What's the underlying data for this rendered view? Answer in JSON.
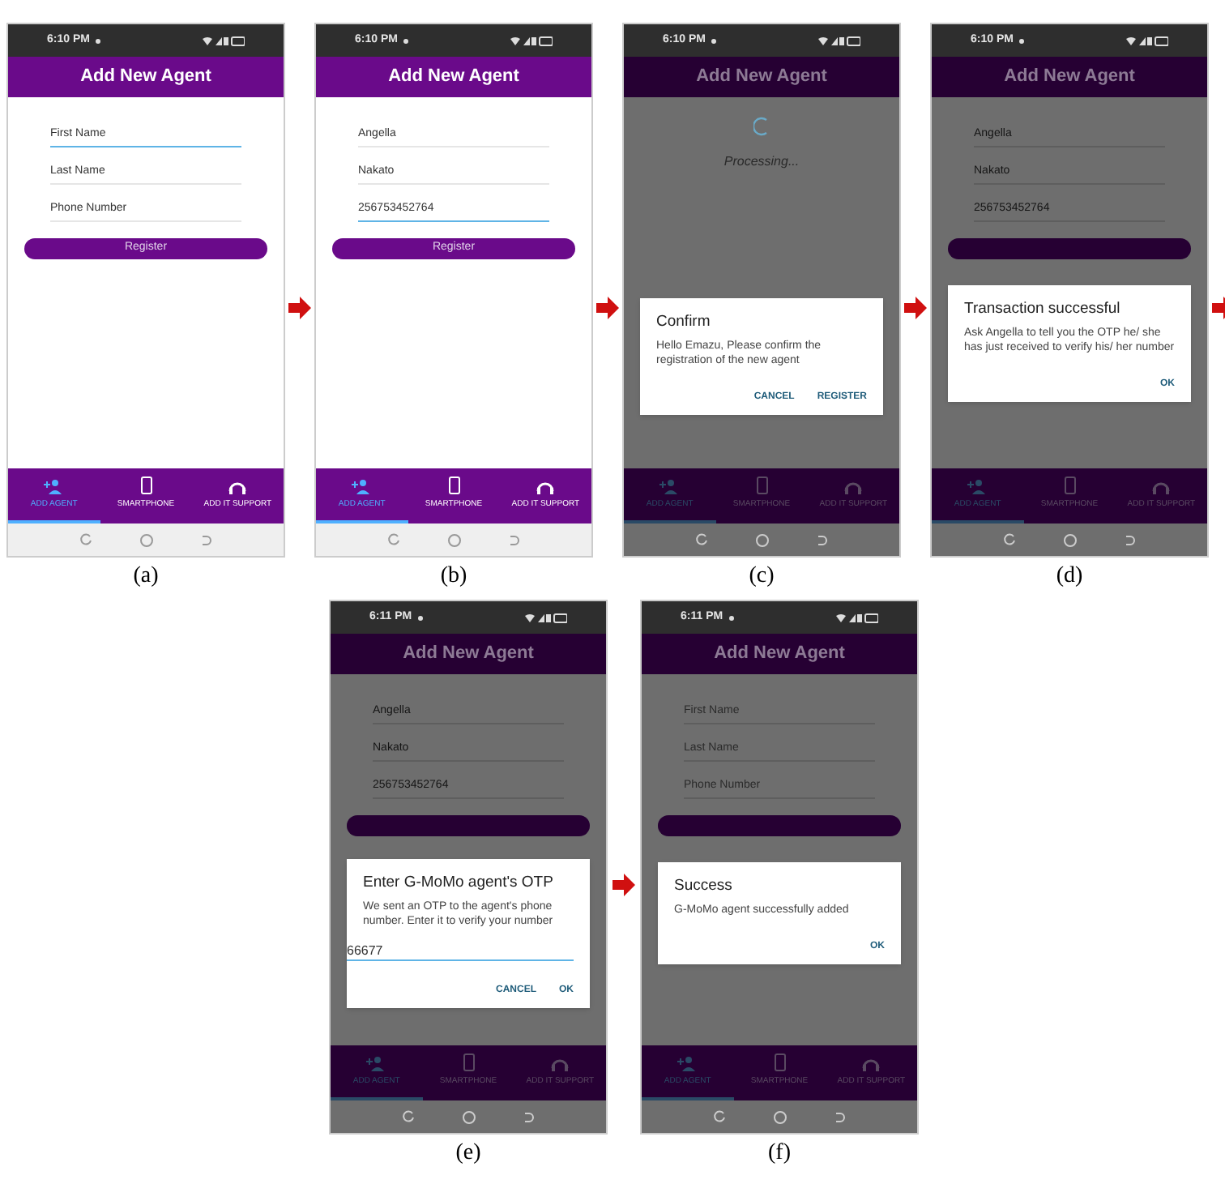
{
  "rows": [
    {
      "items": [
        {
          "kind": "phone",
          "caption": "(a)",
          "time": "6:10 PM",
          "title": "Add New Agent",
          "dimmed": false,
          "fields": [
            {
              "placeholder": "First Name",
              "focused": true
            },
            {
              "placeholder": "Last Name",
              "focused": false
            },
            {
              "placeholder": "Phone Number",
              "focused": false
            }
          ],
          "register_button": {
            "label": "Register"
          },
          "tabs": [
            {
              "label": "ADD AGENT",
              "selected": true
            },
            {
              "label": "SMARTPHONE",
              "selected": false
            },
            {
              "label": "ADD IT SUPPORT",
              "selected": false
            }
          ]
        },
        {
          "kind": "arrow"
        },
        {
          "kind": "phone",
          "caption": "(b)",
          "time": "6:10 PM",
          "title": "Add New Agent",
          "dimmed": false,
          "fields": [
            {
              "value": "Angella",
              "focused": false
            },
            {
              "value": "Nakato",
              "focused": false
            },
            {
              "value": "256753452764",
              "focused": true
            }
          ],
          "register_button": {
            "label": "Register"
          },
          "tabs": [
            {
              "label": "ADD AGENT",
              "selected": true
            },
            {
              "label": "SMARTPHONE",
              "selected": false
            },
            {
              "label": "ADD IT SUPPORT",
              "selected": false
            }
          ]
        },
        {
          "kind": "arrow"
        },
        {
          "kind": "phone",
          "caption": "(c)",
          "time": "6:10 PM",
          "title": "Add New Agent",
          "dimmed": true,
          "processing": {
            "text": "Processing..."
          },
          "dialog": {
            "title": "Confirm",
            "message": "Hello Emazu, Please confirm the registration of the new agent",
            "actions": [
              "CANCEL",
              "REGISTER"
            ]
          },
          "tabs": [
            {
              "label": "ADD AGENT",
              "selected": true
            },
            {
              "label": "SMARTPHONE",
              "selected": false
            },
            {
              "label": "ADD IT SUPPORT",
              "selected": false
            }
          ]
        },
        {
          "kind": "arrow"
        },
        {
          "kind": "phone",
          "caption": "(d)",
          "time": "6:10 PM",
          "title": "Add New Agent",
          "dimmed": true,
          "fields": [
            {
              "value": "Angella",
              "focused": false
            },
            {
              "value": "Nakato",
              "focused": false
            },
            {
              "value": "256753452764",
              "focused": false
            }
          ],
          "register_button": {
            "shown": true
          },
          "dialog": {
            "title": "Transaction successful",
            "message": "Ask Angella to tell you the OTP he/ she has just received to verify his/ her number",
            "actions": [
              "OK"
            ]
          },
          "tabs": [
            {
              "label": "ADD AGENT",
              "selected": true
            },
            {
              "label": "SMARTPHONE",
              "selected": false
            },
            {
              "label": "ADD IT SUPPORT",
              "selected": false
            }
          ]
        },
        {
          "kind": "arrow"
        }
      ]
    },
    {
      "items": [
        {
          "kind": "phone",
          "caption": "(e)",
          "time": "6:11 PM",
          "title": "Add New Agent",
          "dimmed": true,
          "fields": [
            {
              "value": "Angella",
              "focused": false
            },
            {
              "value": "Nakato",
              "focused": false
            },
            {
              "value": "256753452764",
              "focused": false
            }
          ],
          "register_button": {
            "shown": true
          },
          "dialog": {
            "title": "Enter G-MoMo agent's OTP",
            "message": "We sent an OTP to the agent's phone number. Enter it to verify your number",
            "input_value": "66677",
            "actions": [
              "CANCEL",
              "OK"
            ]
          },
          "tabs": [
            {
              "label": "ADD AGENT",
              "selected": true
            },
            {
              "label": "SMARTPHONE",
              "selected": false
            },
            {
              "label": "ADD IT SUPPORT",
              "selected": false
            }
          ]
        },
        {
          "kind": "arrow"
        },
        {
          "kind": "phone",
          "caption": "(f)",
          "time": "6:11 PM",
          "title": "Add New Agent",
          "dimmed": true,
          "fields": [
            {
              "placeholder": "First Name",
              "focused": false
            },
            {
              "placeholder": "Last Name",
              "focused": false
            },
            {
              "placeholder": "Phone Number",
              "focused": false
            }
          ],
          "register_button": {
            "shown": true
          },
          "dialog": {
            "title": "Success",
            "message": "G-MoMo agent successfully added",
            "actions": [
              "OK"
            ]
          },
          "tabs": [
            {
              "label": "ADD AGENT",
              "selected": true
            },
            {
              "label": "SMARTPHONE",
              "selected": false
            },
            {
              "label": "ADD IT SUPPORT",
              "selected": false
            }
          ]
        }
      ]
    }
  ]
}
